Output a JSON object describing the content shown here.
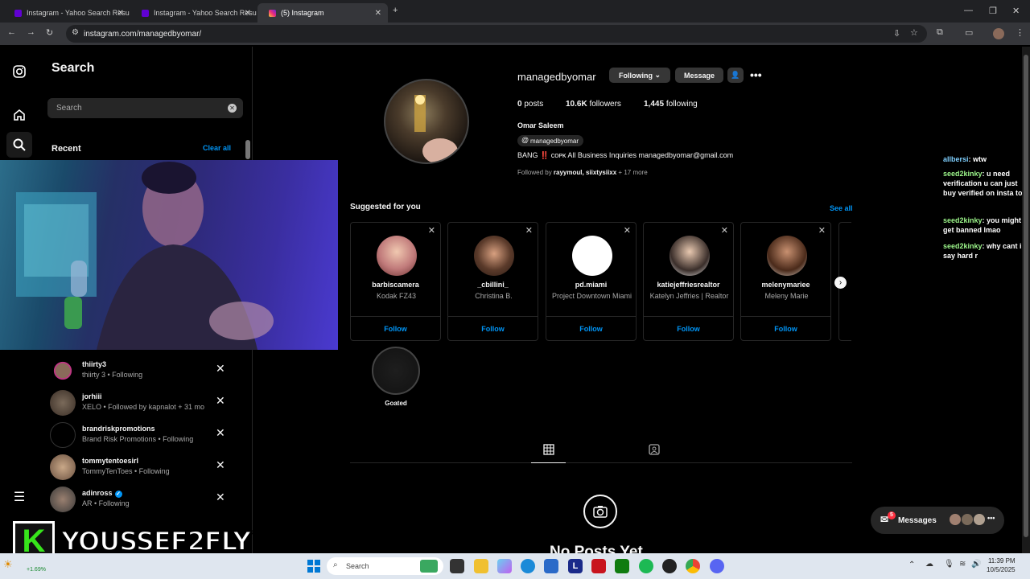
{
  "browser": {
    "tabs": [
      {
        "title": "Instagram - Yahoo Search Resu",
        "active": false
      },
      {
        "title": "Instagram - Yahoo Search Resu",
        "active": false
      },
      {
        "title": "(5) Instagram",
        "active": true
      }
    ],
    "url": "instagram.com/managedbyomar/"
  },
  "search_panel": {
    "title": "Search",
    "placeholder": "Search",
    "recent_label": "Recent",
    "clear_all": "Clear all",
    "items": [
      {
        "name": "thiirty3",
        "sub": "thiirty 3 • Following"
      },
      {
        "name": "jorhiii",
        "sub": "XELO • Followed by kapnalot + 31 mo"
      },
      {
        "name": "brandriskpromotions",
        "sub": "Brand Risk Promotions • Following"
      },
      {
        "name": "tommytentoesirl",
        "sub": "TommyTenToes • Following"
      },
      {
        "name": "adinross",
        "sub": "AR • Following"
      }
    ]
  },
  "profile": {
    "username": "managedbyomar",
    "following_btn": "Following",
    "message_btn": "Message",
    "posts_count": "0",
    "posts_label": "posts",
    "followers_count": "10.6K",
    "followers_label": "followers",
    "following_count": "1,445",
    "following_label": "following",
    "full_name": "Omar Saleem",
    "threads_handle": "managedbyomar",
    "bio": "BANG ‼️ ᴄᴏᴘᴋ All Business Inquiries managedbyomar@gmail.com",
    "followed_by_prefix": "Followed by",
    "followed_by_names": "rayymoul, siixtysiixx",
    "followed_by_more": "+ 17 more"
  },
  "suggested": {
    "title": "Suggested for you",
    "see_all": "See all",
    "follow_label": "Follow",
    "cards": [
      {
        "username": "barbiscamera",
        "name": "Kodak FZ43"
      },
      {
        "username": "_cbillini_",
        "name": "Christina B."
      },
      {
        "username": "pd.miami",
        "name": "Project Downtown Miami"
      },
      {
        "username": "katiejeffriesrealtor",
        "name": "Katelyn Jeffries | Realtor"
      },
      {
        "username": "melenymariee",
        "name": "Meleny Marie"
      }
    ]
  },
  "highlight": {
    "label": "Goated"
  },
  "empty_state": {
    "text": "No Posts Yet"
  },
  "chat": [
    {
      "user": "allbersi",
      "msg": "wtw"
    },
    {
      "user": "seed2kinky",
      "msg": "u need verification u can just buy verified on insta too"
    },
    {
      "user": "seed2kinky",
      "msg": "you might get banned lmao"
    },
    {
      "user": "seed2kinky",
      "msg": "why cant i say hard r"
    }
  ],
  "messages": {
    "label": "Messages",
    "badge": "5"
  },
  "streamer": {
    "letter": "K",
    "name": "YOUSSEF2FLY"
  },
  "taskbar": {
    "search": "Search",
    "time": "11:39 PM",
    "date": "10/5/2025",
    "stock": "+1.69%"
  }
}
